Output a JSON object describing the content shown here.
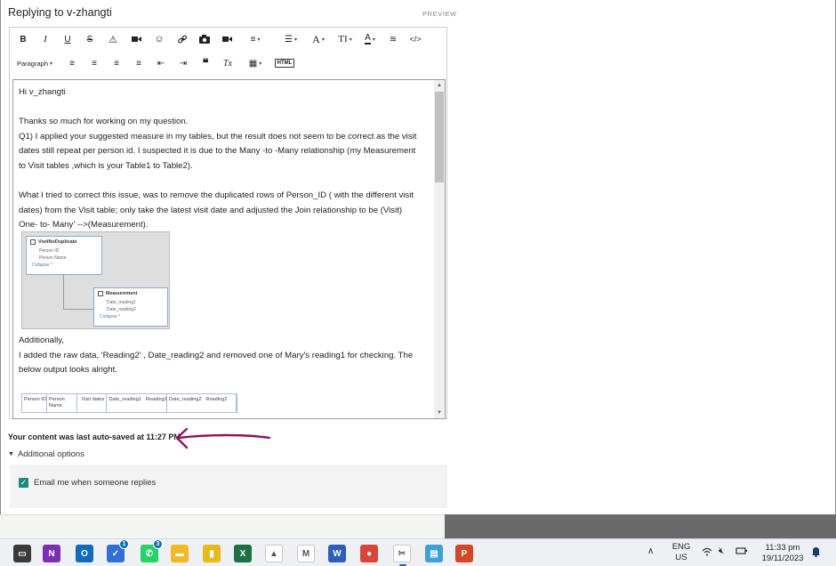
{
  "header": {
    "reply_title": "Replying to v-zhangti",
    "preview_label": "PREVIEW"
  },
  "toolbar": {
    "row1": [
      {
        "name": "bold-button",
        "glyph": "B",
        "style": "bold"
      },
      {
        "name": "italic-button",
        "glyph": "I",
        "style": "italic"
      },
      {
        "name": "underline-button",
        "glyph": "U",
        "style": "underline"
      },
      {
        "name": "strikethrough-button",
        "glyph": "S",
        "style": "strike"
      },
      {
        "name": "spoiler-warning-button",
        "glyph": "⚠",
        "style": ""
      },
      {
        "name": "video-icon-button",
        "glyph": "■",
        "style": ""
      },
      {
        "name": "emoji-button",
        "glyph": "☺",
        "style": ""
      },
      {
        "name": "link-button",
        "glyph": "🔗",
        "style": ""
      },
      {
        "name": "photo-button",
        "glyph": "📷",
        "style": ""
      },
      {
        "name": "insert-video-button",
        "glyph": "▶",
        "style": ""
      },
      {
        "name": "numbered-list-button",
        "glyph": "≡",
        "style": ""
      },
      {
        "name": "bulleted-list-button",
        "glyph": "☰",
        "style": ""
      },
      {
        "name": "font-size-button",
        "glyph": "A",
        "style": ""
      },
      {
        "name": "text-size-button",
        "glyph": "TI",
        "style": ""
      },
      {
        "name": "font-color-button",
        "glyph": "A",
        "style": "underline"
      },
      {
        "name": "clear-style-button",
        "glyph": "≋",
        "style": ""
      },
      {
        "name": "code-view-button",
        "glyph": "</>",
        "style": ""
      }
    ],
    "row2_paragraph": "Paragraph",
    "row2": [
      {
        "name": "align-left-button",
        "glyph": "≡"
      },
      {
        "name": "align-center-button",
        "glyph": "≡"
      },
      {
        "name": "align-right-button",
        "glyph": "≡"
      },
      {
        "name": "justify-button",
        "glyph": "≡"
      },
      {
        "name": "outdent-button",
        "glyph": "⇤"
      },
      {
        "name": "indent-button",
        "glyph": "⇥"
      },
      {
        "name": "quote-button",
        "glyph": "❝"
      },
      {
        "name": "clear-format-button",
        "glyph": "Tx"
      },
      {
        "name": "table-button",
        "glyph": "▦"
      }
    ],
    "html_label": "HTML"
  },
  "content": {
    "greeting": "Hi v_zhangti",
    "para1_line1": "Thanks so much for working on my question.",
    "para1_line2": "Q1) I applied your suggested measure in my tables, but the result does not seem to be correct as the visit",
    "para1_line3": "dates still repeat per person id. I suspected it is due to the Many -to -Many relationship (my Measurement",
    "para1_line4": "to Visit tables ,which is your Table1 to Table2).",
    "para2_line1": "What I tried to correct this issue, was to remove the duplicated rows of Person_ID ( with the different visit",
    "para2_line2": "dates) from the Visit table;  only take the latest visit date and adjusted the Join relationship to be (Visit)",
    "para2_line3": "One- to- Many' -->(Measurement).",
    "para3_line1": "Additionally,",
    "para3_line2": "I added the raw data, 'Reading2' , Date_reading2 and removed one of Mary's reading1 for checking. The",
    "para3_line3": "below output looks alright."
  },
  "diagram": {
    "table1": {
      "title": "VisitNoDuplicate",
      "fields": [
        "Person ID",
        "Person Name"
      ],
      "collapse": "Collapse ^"
    },
    "table2": {
      "title": "Measurement",
      "fields": [
        "Date_reading1",
        "Date_reading2"
      ],
      "collapse": "Collapse ^"
    }
  },
  "mini_table": {
    "columns": [
      "Person ID",
      "Person Name",
      "Visit dates",
      "Date_reading1",
      "Reading1",
      "Date_reading2",
      "Reading2"
    ]
  },
  "footer": {
    "autosave": "Your content was last auto-saved at 11:27 PM",
    "additional_options": "Additional options",
    "email_checkbox_label": "Email me when someone replies",
    "email_checked": true
  },
  "taskbar": {
    "apps": [
      {
        "name": "terminal-icon",
        "color": "#3a3a3a",
        "glyph": "▭"
      },
      {
        "name": "onenote-icon",
        "color": "#7b2fb5",
        "glyph": "N"
      },
      {
        "name": "outlook-icon",
        "color": "#0f6cbd",
        "glyph": "O"
      },
      {
        "name": "todo-icon",
        "color": "#2f6fd6",
        "glyph": "✓",
        "badge": "1"
      },
      {
        "name": "whatsapp-icon",
        "color": "#25d366",
        "glyph": "✆",
        "badge": "3"
      },
      {
        "name": "file-explorer-icon",
        "color": "#f2b924",
        "glyph": "▬"
      },
      {
        "name": "powerbi-icon",
        "color": "#e8b91a",
        "glyph": "▮"
      },
      {
        "name": "excel-icon",
        "color": "#1d7044",
        "glyph": "X"
      },
      {
        "name": "google-drive-icon",
        "color": "#ffffff",
        "glyph": "▲"
      },
      {
        "name": "gmail-icon",
        "color": "#ffffff",
        "glyph": "M"
      },
      {
        "name": "word-icon",
        "color": "#2b5fb8",
        "glyph": "W"
      },
      {
        "name": "chrome-icon",
        "color": "#db4437",
        "glyph": "●"
      },
      {
        "name": "snipping-tool-icon",
        "color": "#ffffff",
        "glyph": "✂"
      },
      {
        "name": "notepad-icon",
        "color": "#3aa2d8",
        "glyph": "▤"
      },
      {
        "name": "powerpoint-icon",
        "color": "#d24726",
        "glyph": "P"
      }
    ],
    "lang_line1": "ENG",
    "lang_line2": "US",
    "time": "11:33 pm",
    "date": "19/11/2023"
  },
  "colors": {
    "accent_teal": "#1c8a7d",
    "annotation_magenta": "#8e1462"
  }
}
